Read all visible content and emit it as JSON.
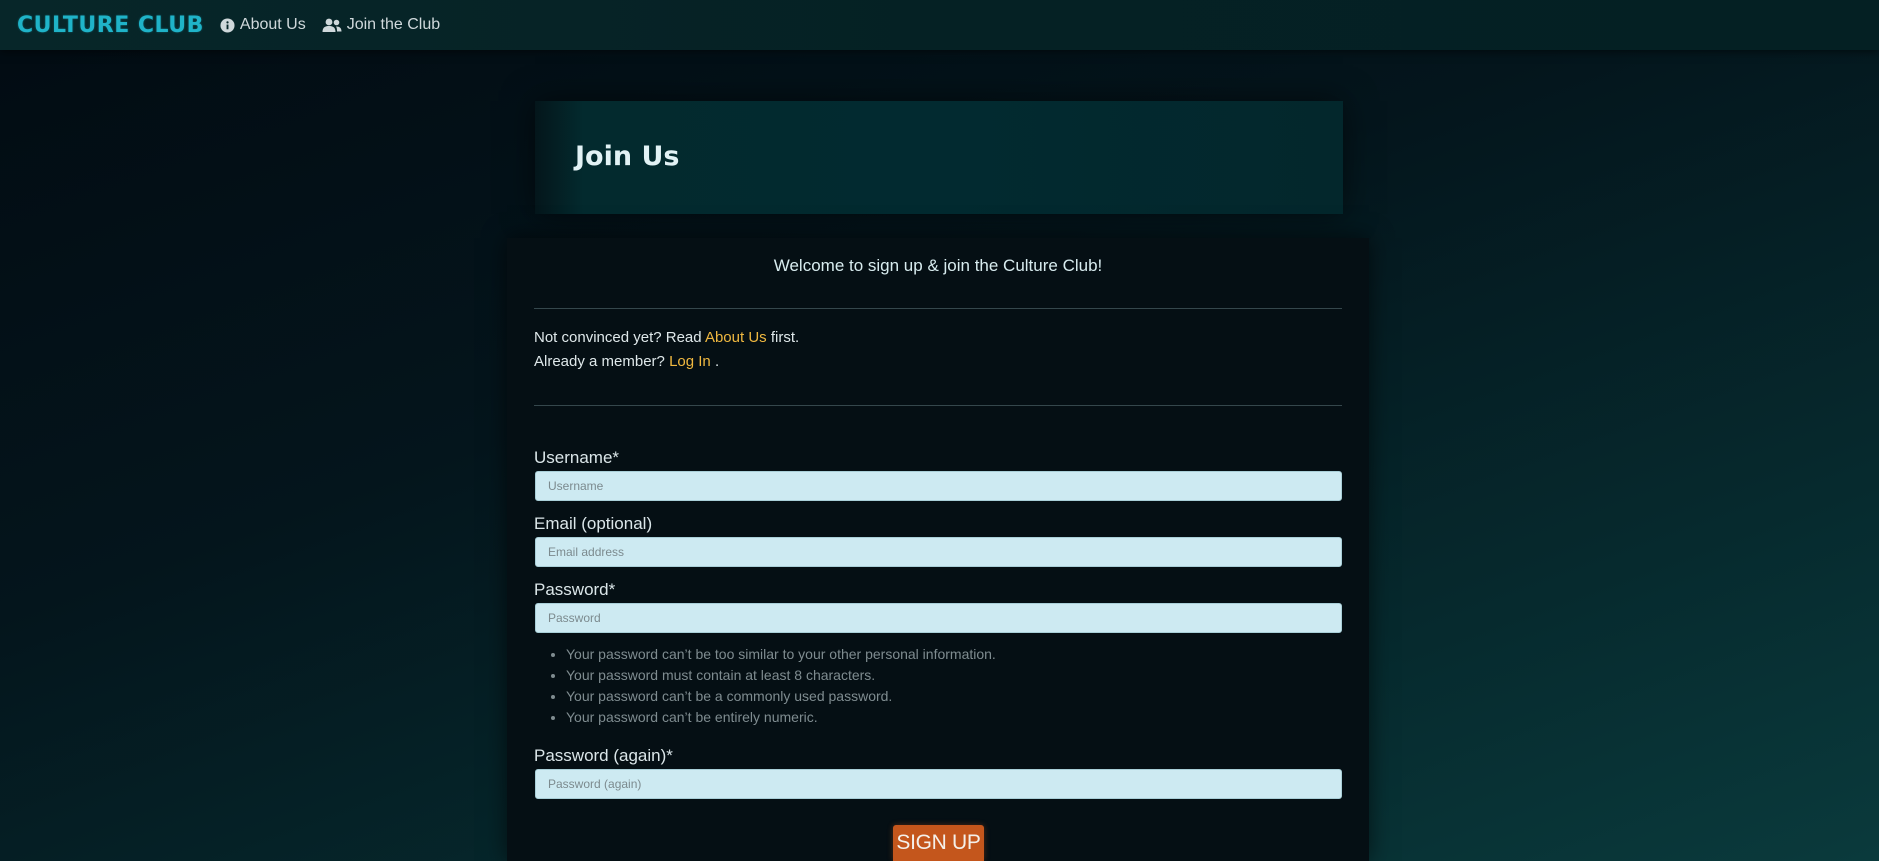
{
  "nav": {
    "brand": "CULTURE CLUB",
    "about_icon": "info-circle-icon",
    "about_label": "About Us",
    "join_icon": "users-icon",
    "join_label": "Join the Club"
  },
  "hero": {
    "title": "Join Us"
  },
  "form": {
    "welcome": "Welcome to sign up & join the Culture Club!",
    "not_convinced_prefix": "Not convinced yet? Read ",
    "about_link": "About Us",
    "not_convinced_suffix": " first.",
    "member_prefix": "Already a member? ",
    "login_link": "Log In",
    "member_suffix": " .",
    "username_label": "Username*",
    "username_placeholder": "Username",
    "email_label": "Email (optional)",
    "email_placeholder": "Email address",
    "password_label": "Password*",
    "password_placeholder": "Password",
    "password_hints": [
      "Your password can’t be too similar to your other personal information.",
      "Your password must contain at least 8 characters.",
      "Your password can’t be a commonly used password.",
      "Your password can’t be entirely numeric."
    ],
    "password2_label": "Password (again)*",
    "password2_placeholder": "Password (again)",
    "submit_label": "SIGN UP"
  },
  "colors": {
    "brand": "#1fb3c8",
    "link": "#f0b840",
    "button": "#c4561c",
    "input_bg": "#cdeaf2"
  }
}
